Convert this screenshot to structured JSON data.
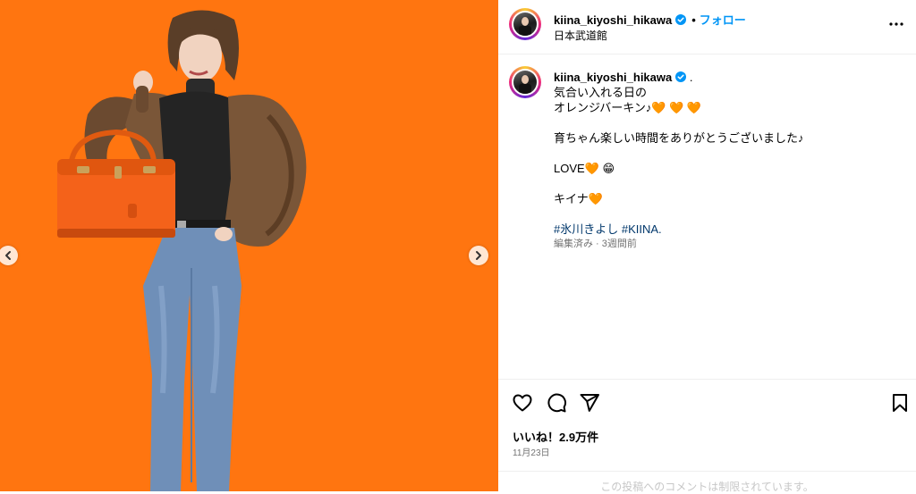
{
  "post": {
    "username": "kiina_kiyoshi_hikawa",
    "follow_label": "フォロー",
    "location": "日本武道館",
    "separator": "•"
  },
  "caption": {
    "username": "kiina_kiyoshi_hikawa",
    "suffix": ".",
    "line1": "気合い入れる日の",
    "line2": "オレンジバーキン♪🧡 🧡 🧡",
    "line3": "育ちゃん楽しい時間をありがとうございました♪",
    "line4": "LOVE🧡 😁",
    "line5": "キイナ🧡",
    "hashtag1": "#氷川きよし",
    "hashtag2": "#KIINA.",
    "meta": "編集済み · 3週間前"
  },
  "engagement": {
    "likes": "いいね！2.9万件",
    "date": "11月23日",
    "comment_hint": "この投稿へのコメントは制限されています。"
  },
  "icons": {
    "verified": "verified-badge-icon",
    "more": "more-options-icon",
    "like": "heart-icon",
    "comment": "comment-icon",
    "share": "share-icon",
    "save": "bookmark-icon",
    "prev": "chevron-left-icon",
    "next": "chevron-right-icon"
  },
  "colors": {
    "media_background": "#ff7510",
    "link": "#0095f6",
    "hashtag": "#00376b",
    "verified": "#0095f6",
    "secondary_text": "#737373"
  }
}
